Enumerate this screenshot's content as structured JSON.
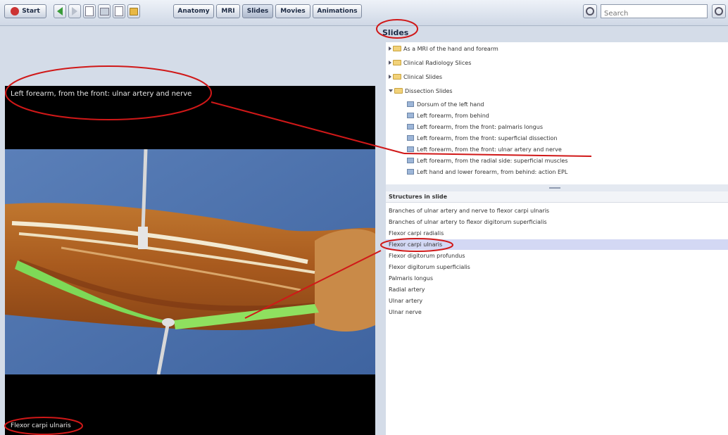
{
  "toolbar": {
    "start_label": "Start",
    "tabs": [
      {
        "label": "Anatomy"
      },
      {
        "label": "MRI"
      },
      {
        "label": "Slides",
        "active": true
      },
      {
        "label": "Movies"
      },
      {
        "label": "Animations"
      }
    ],
    "search_placeholder": "Search"
  },
  "viewer": {
    "title": "Left forearm, from the front: ulnar artery and nerve",
    "structure_caption": "Flexor carpi ulnaris"
  },
  "slides": {
    "label": "Slides",
    "tree": [
      {
        "type": "folder",
        "label": "As a MRI of the hand and forearm",
        "expanded": false
      },
      {
        "type": "folder",
        "label": "Clinical Radiology Slices",
        "expanded": false
      },
      {
        "type": "folder",
        "label": "Clinical Slides",
        "expanded": false
      },
      {
        "type": "folder",
        "label": "Dissection Slides",
        "expanded": true
      },
      {
        "type": "slide",
        "label": "Dorsum of the left hand"
      },
      {
        "type": "slide",
        "label": "Left forearm, from behind"
      },
      {
        "type": "slide",
        "label": "Left forearm, from the front: palmaris longus"
      },
      {
        "type": "slide",
        "label": "Left forearm, from the front: superficial dissection"
      },
      {
        "type": "slide",
        "label": "Left forearm, from the front: ulnar artery and nerve"
      },
      {
        "type": "slide",
        "label": "Left forearm, from the radial side: superficial muscles"
      },
      {
        "type": "slide",
        "label": "Left hand and lower forearm, from behind: action EPL"
      }
    ]
  },
  "structures": {
    "header": "Structures in slide",
    "items": [
      "Branches of ulnar artery and nerve to flexor carpi ulnaris",
      "Branches of ulnar artery to flexor digitorum superficialis",
      "Flexor carpi radialis",
      "Flexor carpi ulnaris",
      "Flexor digitorum profundus",
      "Flexor digitorum superficialis",
      "Palmaris longus",
      "Radial artery",
      "Ulnar artery",
      "Ulnar nerve"
    ],
    "selected_index": 3
  },
  "colors": {
    "annotation": "#d01818",
    "highlight_muscle": "#7ed957",
    "selected_row": "#d3d8f4"
  }
}
